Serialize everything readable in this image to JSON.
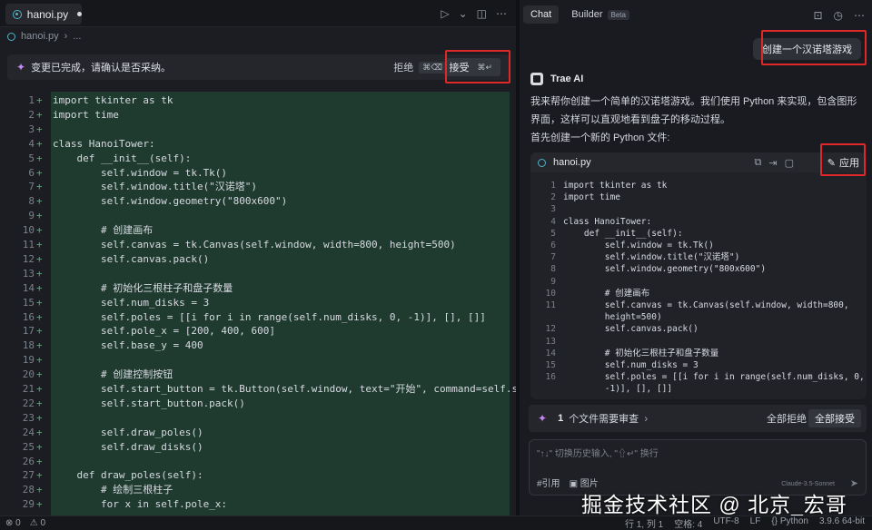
{
  "editor": {
    "tab_label": "hanoi.py",
    "breadcrumb_file": "hanoi.py",
    "breadcrumb_more": "...",
    "review_message": "变更已完成，请确认是否采纳。",
    "reject_label": "拒绝",
    "reject_kbd": "⌘⌫",
    "accept_label": "接受",
    "accept_kbd": "⌘↵"
  },
  "code_lines": [
    {
      "n": "1",
      "t": "import tkinter as tk"
    },
    {
      "n": "2",
      "t": "import time"
    },
    {
      "n": "3",
      "t": ""
    },
    {
      "n": "4",
      "t": "class HanoiTower:"
    },
    {
      "n": "5",
      "t": "    def __init__(self):"
    },
    {
      "n": "6",
      "t": "        self.window = tk.Tk()"
    },
    {
      "n": "7",
      "t": "        self.window.title(\"汉诺塔\")"
    },
    {
      "n": "8",
      "t": "        self.window.geometry(\"800x600\")"
    },
    {
      "n": "9",
      "t": ""
    },
    {
      "n": "10",
      "t": "        # 创建画布"
    },
    {
      "n": "11",
      "t": "        self.canvas = tk.Canvas(self.window, width=800, height=500)"
    },
    {
      "n": "12",
      "t": "        self.canvas.pack()"
    },
    {
      "n": "13",
      "t": ""
    },
    {
      "n": "14",
      "t": "        # 初始化三根柱子和盘子数量"
    },
    {
      "n": "15",
      "t": "        self.num_disks = 3"
    },
    {
      "n": "16",
      "t": "        self.poles = [[i for i in range(self.num_disks, 0, -1)], [], []]"
    },
    {
      "n": "17",
      "t": "        self.pole_x = [200, 400, 600]"
    },
    {
      "n": "18",
      "t": "        self.base_y = 400"
    },
    {
      "n": "19",
      "t": ""
    },
    {
      "n": "20",
      "t": "        # 创建控制按钮"
    },
    {
      "n": "21",
      "t": "        self.start_button = tk.Button(self.window, text=\"开始\", command=self.start_game)"
    },
    {
      "n": "22",
      "t": "        self.start_button.pack()"
    },
    {
      "n": "23",
      "t": ""
    },
    {
      "n": "24",
      "t": "        self.draw_poles()"
    },
    {
      "n": "25",
      "t": "        self.draw_disks()"
    },
    {
      "n": "26",
      "t": ""
    },
    {
      "n": "27",
      "t": "    def draw_poles(self):"
    },
    {
      "n": "28",
      "t": "        # 绘制三根柱子"
    },
    {
      "n": "29",
      "t": "        for x in self.pole_x:"
    }
  ],
  "chat": {
    "tab_chat": "Chat",
    "tab_builder": "Builder",
    "beta": "Beta",
    "user_message": "创建一个汉诺塔游戏",
    "ai_name": "Trae AI",
    "ai_para1": "我来帮你创建一个简单的汉诺塔游戏。我们使用 Python 来实现，包含图形界面，这样可以直观地看到盘子的移动过程。",
    "ai_para2": "首先创建一个新的 Python 文件:",
    "card_file": "hanoi.py",
    "apply_label": "应用",
    "card_lines": [
      {
        "n": "1",
        "t": "import tkinter as tk"
      },
      {
        "n": "2",
        "t": "import time"
      },
      {
        "n": "3",
        "t": ""
      },
      {
        "n": "4",
        "t": "class HanoiTower:"
      },
      {
        "n": "5",
        "t": "    def __init__(self):"
      },
      {
        "n": "6",
        "t": "        self.window = tk.Tk()"
      },
      {
        "n": "7",
        "t": "        self.window.title(\"汉诺塔\")"
      },
      {
        "n": "8",
        "t": "        self.window.geometry(\"800x600\")"
      },
      {
        "n": "9",
        "t": ""
      },
      {
        "n": "10",
        "t": "        # 创建画布"
      },
      {
        "n": "11",
        "t": "        self.canvas = tk.Canvas(self.window, width=800,"
      },
      {
        "n": "",
        "t": "        height=500)"
      },
      {
        "n": "12",
        "t": "        self.canvas.pack()"
      },
      {
        "n": "13",
        "t": ""
      },
      {
        "n": "14",
        "t": "        # 初始化三根柱子和盘子数量"
      },
      {
        "n": "15",
        "t": "        self.num_disks = 3"
      },
      {
        "n": "16",
        "t": "        self.poles = [[i for i in range(self.num_disks, 0,"
      },
      {
        "n": "",
        "t": "        -1)], [], []]"
      }
    ],
    "review_count": "1",
    "review_text": "个文件需要审查",
    "reject_all": "全部拒绝",
    "accept_all": "全部接受",
    "input_placeholder": "\"↑↓\" 切换历史输入, \"⇧↵\" 换行",
    "ref_label": "#引用",
    "image_label": "图片",
    "model_label": "Claude-3.5-Sonnet"
  },
  "watermark": "掘金技术社区 @ 北京_宏哥",
  "status": {
    "errors": "0",
    "warnings": "0",
    "position": "行 1, 列 1",
    "spaces": "空格: 4",
    "encoding": "UTF-8",
    "eol": "LF",
    "language": "Python",
    "interpreter": "3.9.6 64-bit"
  },
  "colors": {
    "accent_red_box": "#e02828",
    "diff_green": "#1f3a2e",
    "background": "#1c1d22"
  }
}
